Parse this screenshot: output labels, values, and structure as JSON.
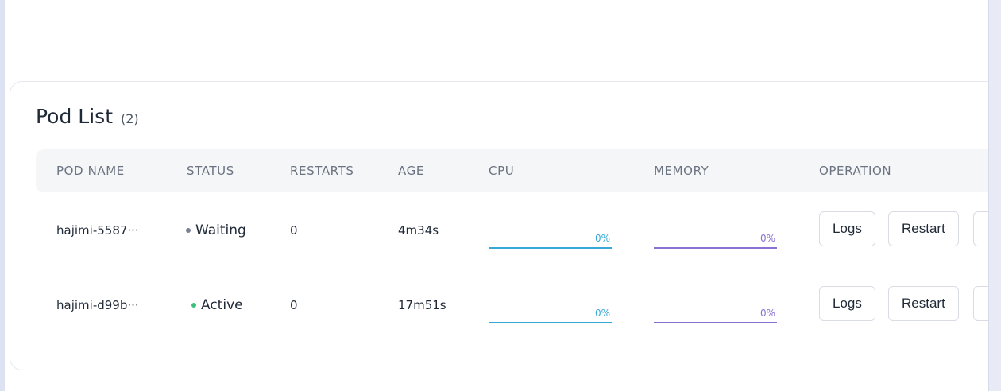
{
  "pod_list": {
    "title": "Pod List",
    "count": "(2)",
    "columns": {
      "pod_name": "POD NAME",
      "status": "STATUS",
      "restarts": "RESTARTS",
      "age": "AGE",
      "cpu": "CPU",
      "memory": "MEMORY",
      "operation": "OPERATION"
    },
    "rows": [
      {
        "name": "hajimi-5587···",
        "status": "Waiting",
        "status_color": "#7b7f95",
        "restarts": "0",
        "age": "4m34s",
        "cpu": "0%",
        "memory": "0%",
        "logs_label": "Logs",
        "restart_label": "Restart"
      },
      {
        "name": "hajimi-d99b···",
        "status": "Active",
        "status_color": "#3fbf7f",
        "restarts": "0",
        "age": "17m51s",
        "cpu": "0%",
        "memory": "0%",
        "logs_label": "Logs",
        "restart_label": "Restart"
      }
    ]
  },
  "colors": {
    "cpu": "#38a9d6",
    "memory": "#8a71d4"
  }
}
